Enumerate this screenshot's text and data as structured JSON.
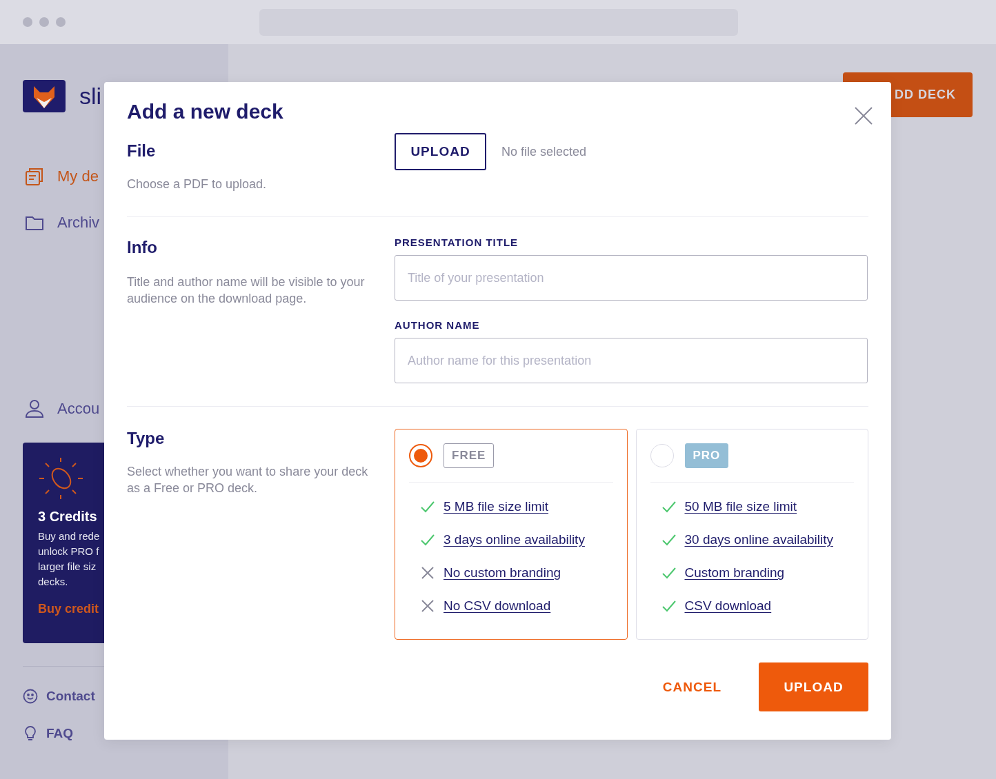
{
  "sidebar": {
    "brand": "sli",
    "nav": [
      {
        "label": "My de",
        "selected": true
      },
      {
        "label": "Archiv",
        "selected": false
      }
    ],
    "account": "Accou",
    "credits": {
      "title": "3 Credits",
      "lines": [
        "Buy and rede",
        "unlock PRO f",
        "larger file siz",
        "decks."
      ],
      "link": "Buy credit"
    },
    "footer_links": [
      "Contact",
      "FAQ"
    ]
  },
  "header": {
    "action": "DD DECK"
  },
  "modal": {
    "title": "Add a new deck",
    "file": {
      "heading": "File",
      "description": "Choose a PDF to upload.",
      "button": "UPLOAD",
      "status": "No file selected"
    },
    "info": {
      "heading": "Info",
      "description": "Title and author name will be visible to your audience on the download page.",
      "fields": [
        {
          "label": "PRESENTATION TITLE",
          "placeholder": "Title of your presentation"
        },
        {
          "label": "AUTHOR NAME",
          "placeholder": "Author name for this presentation"
        }
      ]
    },
    "type": {
      "heading": "Type",
      "description": "Select whether you want to share your deck as a Free or PRO deck.",
      "options": [
        {
          "kind": "free",
          "badge": "FREE",
          "selected": true,
          "features": [
            {
              "text": "5 MB file size limit",
              "included": true
            },
            {
              "text": "3 days online availability",
              "included": true
            },
            {
              "text": "No custom branding",
              "included": false
            },
            {
              "text": "No CSV download",
              "included": false
            }
          ]
        },
        {
          "kind": "pro",
          "badge": "PRO",
          "selected": false,
          "features": [
            {
              "text": "50 MB file size limit",
              "included": true
            },
            {
              "text": "30 days online availability",
              "included": true
            },
            {
              "text": "Custom branding",
              "included": true
            },
            {
              "text": "CSV download",
              "included": true
            }
          ]
        }
      ]
    },
    "actions": {
      "cancel": "CANCEL",
      "submit": "UPLOAD"
    }
  }
}
